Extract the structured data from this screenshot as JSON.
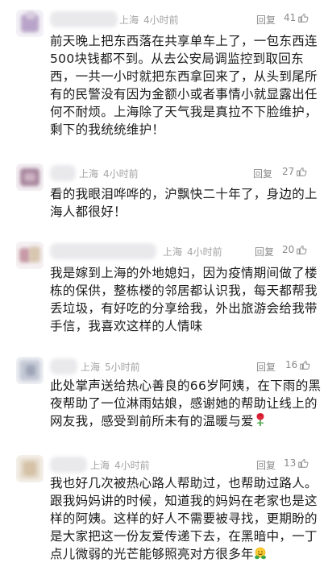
{
  "comments": [
    {
      "location": "上海",
      "time": "4小时前",
      "reply_label": "回复",
      "likes": "41",
      "lines": [
        "前天晚上把东西落在共享单车上了，一包东西连",
        "500块钱都不到。从去公安局调监控到取回东",
        "西，一共一小时就把东西拿回来了，从头到尾所",
        "有的民警没有因为金额小或者事情小就显露出任",
        "何不耐烦。上海除了天气我是真拉不下脸维护，",
        "剩下的我统统维护！"
      ]
    },
    {
      "location": "上海",
      "time": "4小时前",
      "reply_label": "回复",
      "likes": "27",
      "lines": [
        "看的我眼泪哗哗的，沪飘快二十年了，身边的上",
        "海人都很好！"
      ]
    },
    {
      "location": "上海",
      "time": "4小时前",
      "reply_label": "回复",
      "likes": "20",
      "lines": [
        "我是嫁到上海的外地媳妇，因为疫情期间做了楼",
        "栋的保供，整栋楼的邻居都认识我，每天都帮我",
        "丢垃圾，有好吃的分享给我，外出旅游会给我带",
        "手信，我喜欢这样的人情味"
      ]
    },
    {
      "location": "上海",
      "time": "5小时前",
      "reply_label": "回复",
      "likes": "16",
      "lines": [
        "此处掌声送给热心善良的66岁阿姨，在下雨的黑",
        "夜帮助了一位淋雨姑娘，感谢她的帮助让线上的",
        "网友我，感受到前所未有的温暖与爱"
      ]
    },
    {
      "location": "上海",
      "time": "4小时前",
      "reply_label": "回复",
      "likes": "13",
      "lines": [
        "我也好几次被热心路人帮助过，也帮助过路人。",
        "跟我妈妈讲的时候，知道我的妈妈在老家也是这",
        "样的阿姨。这样的好人不需要被寻找，更期盼的",
        "是大家把这一份友爱传递下去，在黑暗中，一丁",
        "点儿微弱的光芒能够照亮对方很多年"
      ]
    }
  ],
  "icons": {
    "like": "thumbs-up-icon",
    "rose": "rose-emoji",
    "hug": "hugging-emoji"
  },
  "colors": {
    "meta_text": "#a3a3a3",
    "body_text": "#1a1a1a",
    "blur_gray": "#e9e9ec"
  }
}
